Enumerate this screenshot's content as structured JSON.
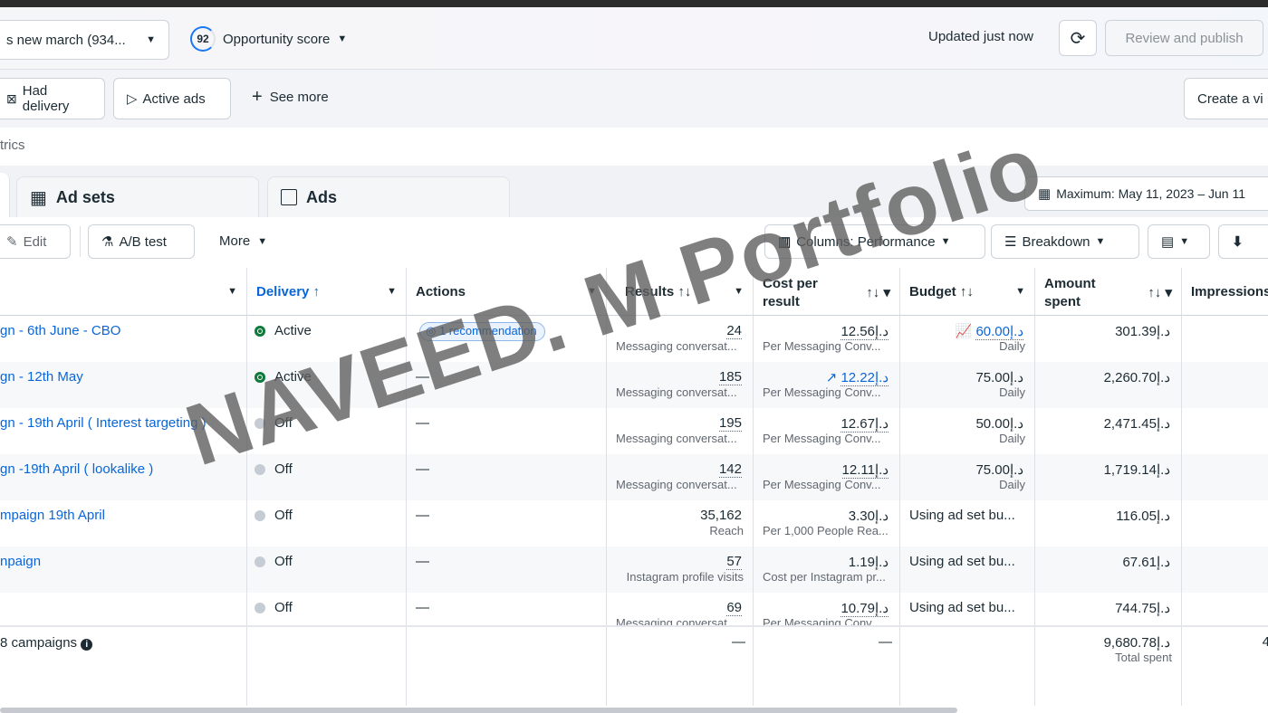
{
  "header": {
    "campaign_select": "s new march (934...",
    "opportunity_score": "92",
    "opportunity_label": "Opportunity score",
    "updated": "Updated just now",
    "review_publish": "Review and publish"
  },
  "filters": {
    "had_delivery": "Had delivery",
    "active_ads": "Active ads",
    "see_more": "See more",
    "create_view": "Create a vi",
    "metrics_label": "trics"
  },
  "tabs": {
    "ad_sets": "Ad sets",
    "ads": "Ads",
    "date_range": "Maximum: May 11, 2023 – Jun 11"
  },
  "toolbar": {
    "edit": "Edit",
    "ab_test": "A/B test",
    "more": "More",
    "columns": "Columns: Performance",
    "breakdown": "Breakdown"
  },
  "columns": {
    "delivery": "Delivery ↑",
    "actions": "Actions",
    "results": "Results ↑↓",
    "cost_per_result": "Cost per result",
    "budget": "Budget ↑↓",
    "amount_spent": "Amount spent",
    "impressions": "Impressions"
  },
  "rows": [
    {
      "name": "gn - 6th June - CBO",
      "delivery": "Active",
      "action": "1 recommendation",
      "result": "24",
      "result_type": "Messaging conversat...",
      "cost": "12.56د.إ",
      "cost_type": "Per Messaging Conv...",
      "budget": "60.00د.إ",
      "budget_type": "Daily",
      "spent": "301.39د.إ"
    },
    {
      "name": "gn - 12th May",
      "delivery": "Active",
      "action": "—",
      "result": "185",
      "result_type": "Messaging conversat...",
      "cost": "12.22د.إ",
      "cost_type": "Per Messaging Conv...",
      "budget": "75.00د.إ",
      "budget_type": "Daily",
      "spent": "2,260.70د.إ"
    },
    {
      "name": "gn - 19th April ( Interest targeting )",
      "delivery": "Off",
      "action": "—",
      "result": "195",
      "result_type": "Messaging conversat...",
      "cost": "12.67د.إ",
      "cost_type": "Per Messaging Conv...",
      "budget": "50.00د.إ",
      "budget_type": "Daily",
      "spent": "2,471.45د.إ"
    },
    {
      "name": "gn -19th April ( lookalike )",
      "delivery": "Off",
      "action": "—",
      "result": "142",
      "result_type": "Messaging conversat...",
      "cost": "12.11د.إ",
      "cost_type": "Per Messaging Conv...",
      "budget": "75.00د.إ",
      "budget_type": "Daily",
      "spent": "1,719.14د.إ"
    },
    {
      "name": "mpaign 19th April",
      "delivery": "Off",
      "action": "—",
      "result": "35,162",
      "result_type": "Reach",
      "cost": "3.30د.إ",
      "cost_type": "Per 1,000 People Rea...",
      "budget": "Using ad set bu...",
      "budget_type": "",
      "spent": "116.05د.إ"
    },
    {
      "name": "npaign",
      "delivery": "Off",
      "action": "—",
      "result": "57",
      "result_type": "Instagram profile visits",
      "cost": "1.19د.إ",
      "cost_type": "Cost per Instagram pr...",
      "budget": "Using ad set bu...",
      "budget_type": "",
      "spent": "67.61د.إ"
    },
    {
      "name": "",
      "delivery": "Off",
      "action": "—",
      "result": "69",
      "result_type": "Messaging conversat...",
      "cost": "10.79د.إ",
      "cost_type": "Per Messaging Conv...",
      "budget": "Using ad set bu...",
      "budget_type": "",
      "spent": "744.75د.إ"
    }
  ],
  "totals": {
    "label": "8 campaigns",
    "results": "—",
    "cost": "—",
    "spent": "9,680.78د.إ",
    "spent_label": "Total spent",
    "impressions": "4"
  },
  "watermark": "NAVEED. M Portfolio"
}
